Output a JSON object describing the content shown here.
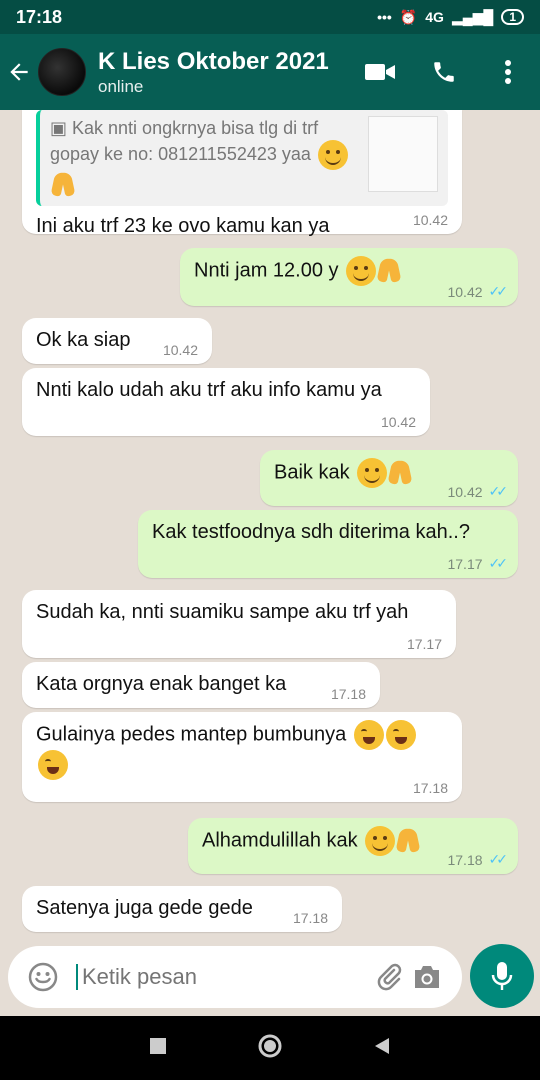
{
  "status": {
    "time": "17:18",
    "dots": "•••",
    "network": "4G",
    "battery": "1"
  },
  "header": {
    "name": "K Lies Oktober 2021",
    "status": "online"
  },
  "messages": [
    {
      "quote": "Kak nnti ongkrnya bisa tlg di trf gopay ke no: 081211552423 yaa",
      "text": "Ini aku trf 23 ke ovo kamu kan ya",
      "time": "10.42"
    },
    {
      "text": "Nnti jam 12.00 y",
      "time": "10.42"
    },
    {
      "text": "Ok ka siap",
      "time": "10.42"
    },
    {
      "text": "Nnti kalo udah aku trf aku info kamu ya",
      "time": "10.42"
    },
    {
      "text": "Baik kak",
      "time": "10.42"
    },
    {
      "text": "Kak testfoodnya sdh diterima kah..?",
      "time": "17.17"
    },
    {
      "text": "Sudah ka, nnti suamiku sampe aku trf yah",
      "time": "17.17"
    },
    {
      "text": "Kata orgnya enak banget ka",
      "time": "17.18"
    },
    {
      "text": "Gulainya pedes mantep bumbunya",
      "time": "17.18"
    },
    {
      "text": "Alhamdulillah kak",
      "time": "17.18"
    },
    {
      "text": "Satenya juga gede gede",
      "time": "17.18"
    }
  ],
  "composer": {
    "placeholder": "Ketik pesan"
  },
  "colors": {
    "header": "#075e54",
    "outgoing": "#dcf8c6",
    "mic": "#00897b"
  }
}
